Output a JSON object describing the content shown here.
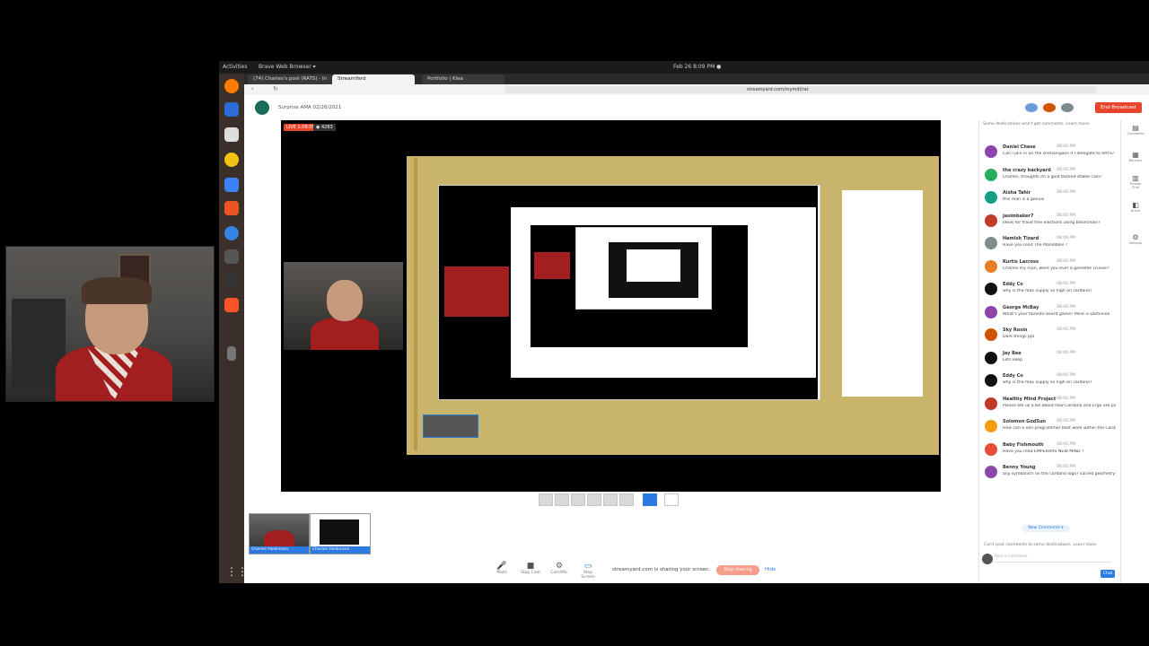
{
  "system": {
    "activities": "Activities",
    "app_menu": "Brave Web Browser ▾",
    "clock": "Feb 26  8:09 PM ●"
  },
  "browser": {
    "tabs": [
      {
        "label": "(74) Charles's pool (RATS) - In"
      },
      {
        "label": "StreamYard"
      },
      {
        "label": "Portfolio | Klea"
      }
    ],
    "url": "streamyard.com/mymdl/rat"
  },
  "studio": {
    "broadcast_title": "Surprise AMA 02/26/2021",
    "end_broadcast": "End Broadcast",
    "live_label": "LIVE 1:08:05",
    "viewers": "◉ 4283",
    "share_message": "streamyard.com is sharing your screen.",
    "stop_sharing": "Stop sharing",
    "hide": "Hide",
    "controls": [
      {
        "icon": "🎤",
        "label": "Mute"
      },
      {
        "icon": "■",
        "label": "Stop Cam"
      },
      {
        "icon": "⚙",
        "label": "Cam/Mic"
      },
      {
        "icon": "▭",
        "label": "Stop Screen"
      }
    ],
    "thumbs": [
      {
        "label": "Charles Hoskinson"
      },
      {
        "label": "Charles Hoskinson"
      }
    ]
  },
  "chat": {
    "notice_top": "Some destinations won't get comments. Learn more.",
    "messages": [
      {
        "name": "Daniel Chase",
        "time": "08:06 PM",
        "text": "Can I join in on the shenanigans if I delegate to RATS?",
        "color": "#8e44ad"
      },
      {
        "name": "the crazy backyard",
        "time": "08:06 PM",
        "text": "Charles, thoughts on a gold backed stable coin?",
        "color": "#27ae60"
      },
      {
        "name": "Aisha Tahir",
        "time": "08:06 PM",
        "text": "this man is a genius",
        "color": "#16a085"
      },
      {
        "name": "jasimbaker7",
        "time": "08:06 PM",
        "text": "Ideas for fraud free elections using blockchain?",
        "color": "#c0392b"
      },
      {
        "name": "Hamish Tizard",
        "time": "08:06 PM",
        "text": "Have you read The Mandibles ?",
        "color": "#7f8c8d"
      },
      {
        "name": "Kurtis Lacross",
        "time": "08:06 PM",
        "text": "Charles my man, were you ever a gamefile cruiser?",
        "color": "#e67e22"
      },
      {
        "name": "Eddy Co",
        "time": "08:06 PM",
        "text": "why is the max supply so high on cardano?",
        "color": "#111111"
      },
      {
        "name": "George McBay",
        "time": "08:06 PM",
        "text": "What's your favorite board game? Mine is Dominion",
        "color": "#8e44ad"
      },
      {
        "name": "Sky Rosin",
        "time": "08:06 PM",
        "text": "Dark things ppl",
        "color": "#d35400"
      },
      {
        "name": "Jay Bee",
        "time": "08:06 PM",
        "text": "Lets keep",
        "color": "#111111"
      },
      {
        "name": "Eddy Co",
        "time": "08:06 PM",
        "text": "why is the max supply so high on cardano?",
        "color": "#111111"
      },
      {
        "name": "Healthy Mind Project",
        "time": "08:06 PM",
        "text": "Please tell us a bit about how Cardano and Ergo are planning to collaborate. Greetings from Vietnam.",
        "color": "#c0392b"
      },
      {
        "name": "Solomon GodSun",
        "time": "08:06 PM",
        "text": "How can a non-programmer best work within the Cardano community?",
        "color": "#f39c12"
      },
      {
        "name": "Baby Fishmouth",
        "time": "08:06 PM",
        "text": "Have you read EMPERORS NEW MIND ?",
        "color": "#e74c3c"
      },
      {
        "name": "Benny Young",
        "time": "08:06 PM",
        "text": "any symbolism on the cardano logo? sacred geometry?",
        "color": "#8e44ad"
      }
    ],
    "new_comments": "New Comments ▾",
    "notice_bottom": "Can't post comments to some destinations. Learn more",
    "input_placeholder": "Post a comment",
    "chat_button": "Chat"
  },
  "right_sidebar": [
    {
      "icon": "▤",
      "label": "Comments"
    },
    {
      "icon": "▦",
      "label": "Banners"
    },
    {
      "icon": "▥",
      "label": "Private Chat"
    },
    {
      "icon": "◧",
      "label": "Brand"
    },
    {
      "icon": "⚙",
      "label": "Settings"
    }
  ]
}
